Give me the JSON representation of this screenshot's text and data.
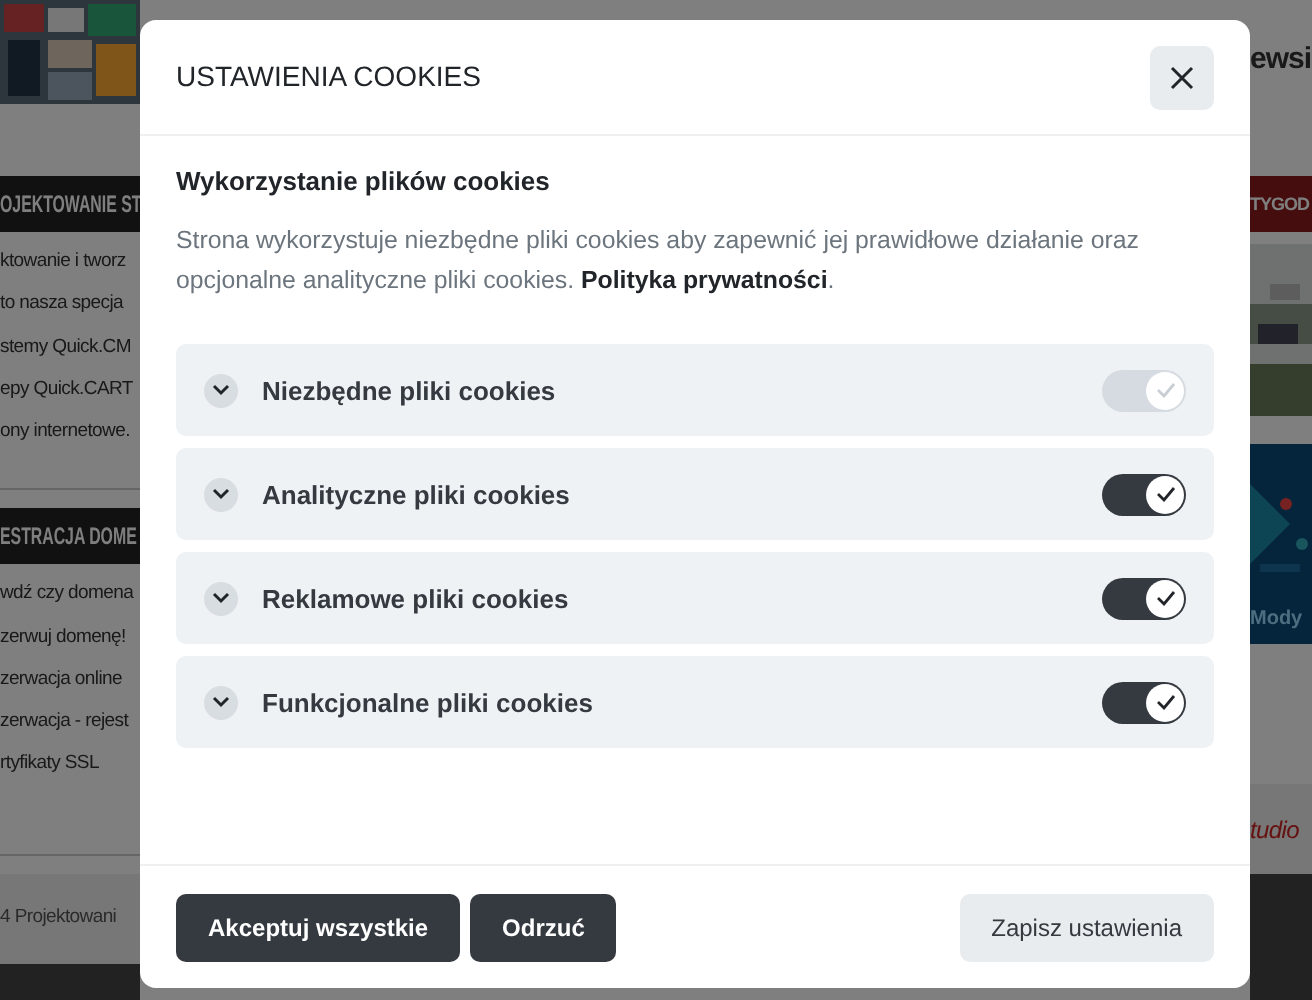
{
  "background_page": {
    "left": {
      "section_1_heading": "OJEKTOWANIE ST",
      "section_1_links": [
        "ktowanie i tworz",
        "to nasza specja",
        "stemy Quick.CM",
        "epy Quick.CART",
        "ony internetowe."
      ],
      "section_2_heading": "ESTRACJA DOME",
      "section_2_links": [
        "wdź czy domena",
        "zerwuj domenę!",
        "zerwacja online",
        "zerwacja - rejest",
        "rtyfikaty SSL"
      ],
      "footer_text": "4 Projektowani"
    },
    "right": {
      "logo": "ewsi",
      "banner_heading": "TYGOD",
      "banner_text": "Mody",
      "footer_logo": "tudio"
    }
  },
  "modal": {
    "title": "USTAWIENIA COOKIES",
    "heading": "Wykorzystanie plików cookies",
    "description": "Strona wykorzystuje niezbędne pliki cookies aby zapewnić jej prawidłowe działanie oraz opcjonalne analityczne pliki cookies.",
    "policy_link": "Polityka prywatności",
    "after_link": ".",
    "categories": [
      {
        "label": "Niezbędne pliki cookies",
        "checked": true,
        "disabled": true
      },
      {
        "label": "Analityczne pliki cookies",
        "checked": true,
        "disabled": false
      },
      {
        "label": "Reklamowe pliki cookies",
        "checked": true,
        "disabled": false
      },
      {
        "label": "Funkcjonalne pliki cookies",
        "checked": true,
        "disabled": false
      }
    ],
    "buttons": [
      {
        "label": "Akceptuj wszystkie",
        "kind": "dark"
      },
      {
        "label": "Odrzuć",
        "kind": "dark"
      },
      {
        "label": "Zapisz ustawienia",
        "kind": "light"
      }
    ]
  }
}
